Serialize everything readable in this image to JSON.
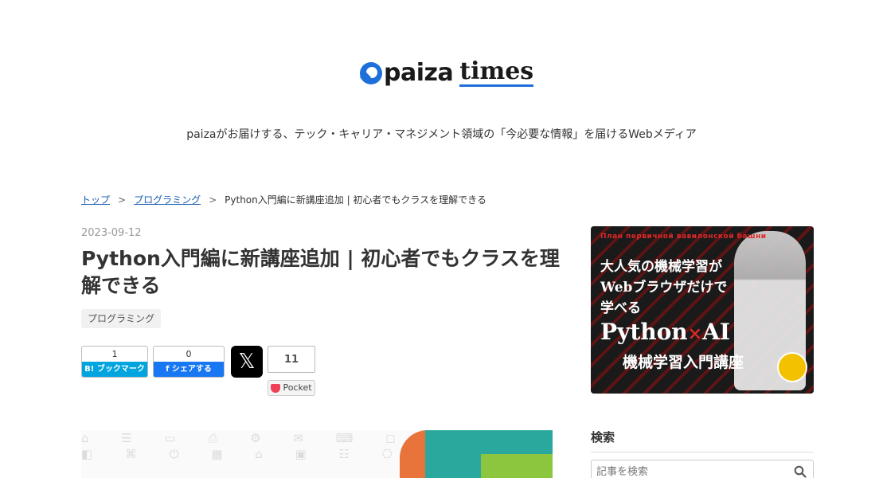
{
  "header": {
    "logo_main": "paiza",
    "logo_sub": "times",
    "tagline": "paizaがお届けする、テック・キャリア・マネジメント領域の「今必要な情報」を届けるWebメディア"
  },
  "breadcrumb": {
    "items": [
      {
        "label": "トップ"
      },
      {
        "label": "プログラミング"
      }
    ],
    "separator": ">",
    "current": "Python入門編に新講座追加 | 初心者でもクラスを理解できる"
  },
  "article": {
    "date": "2023-09-12",
    "title": "Python入門編に新講座追加 | 初心者でもクラスを理解できる",
    "tag": "プログラミング"
  },
  "share": {
    "hatena": {
      "count": "1",
      "label": "B! ブックマーク"
    },
    "facebook": {
      "count": "0",
      "label": "f シェアする"
    },
    "x": {
      "label": "𝕏"
    },
    "pocket": {
      "count": "11",
      "label": "Pocket"
    }
  },
  "ad": {
    "top_text": "План первичной вавилонской башни",
    "line1": "大人気の機械学習が",
    "line2": "Webブラウザだけで",
    "line3": "学べる",
    "python": "Python",
    "times": "×",
    "ai": "AI",
    "course": "機械学習入門講座"
  },
  "sidebar": {
    "search_heading": "検索",
    "search_placeholder": "記事を検索"
  },
  "colors": {
    "brand": "#1e6fd9",
    "link": "#1b5fb3",
    "hatena": "#00a4de",
    "facebook": "#1877f2",
    "pocket": "#ef4056"
  }
}
